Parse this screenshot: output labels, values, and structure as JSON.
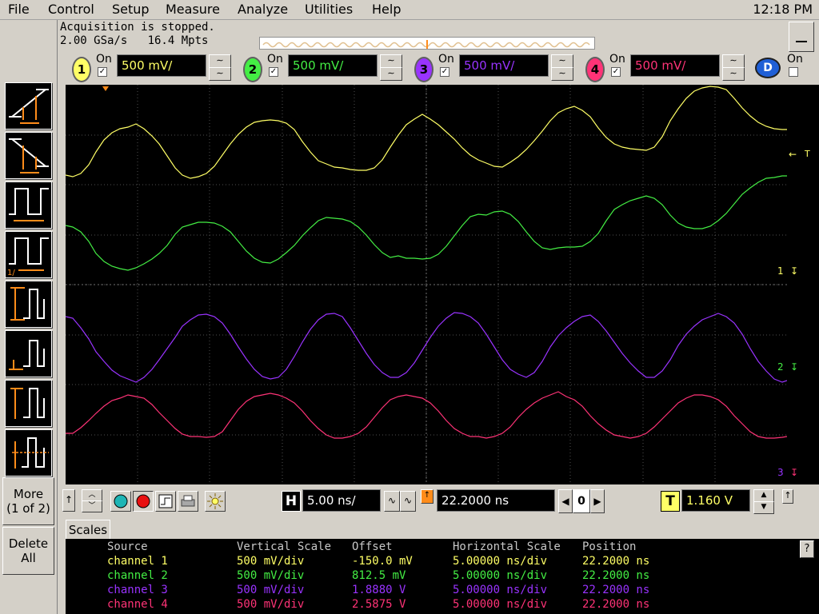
{
  "menu": {
    "items": [
      "File",
      "Control",
      "Setup",
      "Measure",
      "Analyze",
      "Utilities",
      "Help"
    ],
    "clock": "12:18 PM"
  },
  "status": {
    "line1": "Acquisition is stopped.",
    "line2": "2.00 GSa/s   16.4 Mpts"
  },
  "channels": [
    {
      "num": "1",
      "on_label": "On",
      "scale": "500 mV/",
      "color": "#ffff66"
    },
    {
      "num": "2",
      "on_label": "On",
      "scale": "500 mV/",
      "color": "#44ee44"
    },
    {
      "num": "3",
      "on_label": "On",
      "scale": "500 mV/",
      "color": "#9933ff"
    },
    {
      "num": "4",
      "on_label": "On",
      "scale": "500 mV/",
      "color": "#ff3377"
    }
  ],
  "digital": {
    "label": "D",
    "on_label": "On"
  },
  "left_toolbar": {
    "more_label_1": "More",
    "more_label_2": "(1 of 2)",
    "delete_label_1": "Delete",
    "delete_label_2": "All"
  },
  "markers": {
    "trigger": "T",
    "ch1": "1",
    "ch2": "2",
    "ch3": "3"
  },
  "horizontal": {
    "tag": "H",
    "scale": "5.00 ns/",
    "position": "22.2000 ns",
    "delay_index": "0"
  },
  "trigger": {
    "tag": "T",
    "level": "1.160 V"
  },
  "tabs": {
    "scales": "Scales"
  },
  "measurements": {
    "headers": [
      "Source",
      "Vertical Scale",
      "Offset",
      "Horizontal Scale",
      "Position"
    ],
    "rows": [
      {
        "source": "channel 1",
        "vscale": "500 mV/div",
        "offset": "-150.0 mV",
        "hscale": "5.00000 ns/div",
        "position": "22.2000 ns",
        "color": "#ffff66"
      },
      {
        "source": "channel 2",
        "vscale": "500 mV/div",
        "offset": "812.5 mV",
        "hscale": "5.00000 ns/div",
        "position": "22.2000 ns",
        "color": "#44ee44"
      },
      {
        "source": "channel 3",
        "vscale": "500 mV/div",
        "offset": "1.8880 V",
        "hscale": "5.00000 ns/div",
        "position": "22.2000 ns",
        "color": "#9933ff"
      },
      {
        "source": "channel 4",
        "vscale": "500 mV/div",
        "offset": "2.5875 V",
        "hscale": "5.00000 ns/div",
        "position": "22.2000 ns",
        "color": "#ff3377"
      }
    ]
  },
  "help_label": "?"
}
